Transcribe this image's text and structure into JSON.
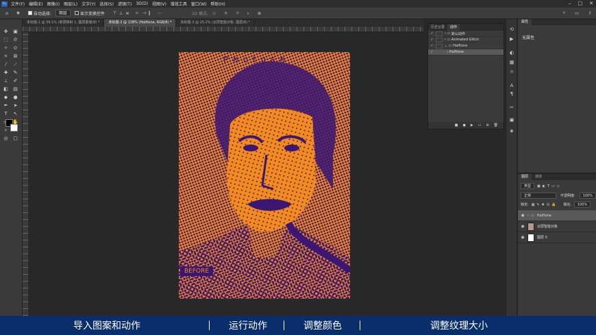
{
  "menu": {
    "items": [
      "文件(F)",
      "编辑(E)",
      "图像(I)",
      "图层(L)",
      "文字(Y)",
      "选择(S)",
      "滤镜(T)",
      "3D(D)",
      "视图(V)",
      "增效工具",
      "窗口(W)",
      "帮助(H)"
    ],
    "logo": "Ps"
  },
  "options": {
    "auto_select": "自动选择:",
    "layer_select": "图层",
    "show_transform": "显示变换控件",
    "mode_3d": "3D 模式:"
  },
  "tabs": [
    "未标题-1 @ 39.1% (新层移射 1, 图层蒙版/8) *",
    "未标题-2 @ 138% (Halftone, RGB/8) *",
    "未标题-3 @ 25.2% (云层智能对象, 图层/8) *"
  ],
  "document": {
    "overlay_text": "Photosh",
    "before_label": "BEFORE"
  },
  "actions_panel": {
    "tabs": [
      "历史记录",
      "动作"
    ],
    "rows": [
      {
        "label": "默认动作",
        "type": "folder"
      },
      {
        "label": "Animated Glitch",
        "type": "folder"
      },
      {
        "label": "Halftone",
        "type": "folder"
      },
      {
        "label": "Halftone",
        "type": "action"
      }
    ]
  },
  "properties": {
    "tab": "属性",
    "content": "无属性"
  },
  "layers_panel": {
    "tabs": [
      "图层",
      "通道"
    ],
    "kind": "类型",
    "blend": "正常",
    "opacity_label": "不透明度:",
    "opacity": "100%",
    "lock_label": "锁定:",
    "fill_label": "填充:",
    "fill": "100%",
    "layers": [
      {
        "name": "Halftone",
        "type": "group"
      },
      {
        "name": "云层智能对象",
        "type": "smart"
      },
      {
        "name": "图层 0",
        "type": "layer"
      }
    ]
  },
  "subtitles": [
    "导入图案和动作",
    "运行动作",
    "调整颜色",
    "调整纹理大小"
  ],
  "colors": {
    "doc_bg": "#f28a1c",
    "halftone": "#3b1672",
    "subtitle_bg": "#0a2e6b"
  }
}
